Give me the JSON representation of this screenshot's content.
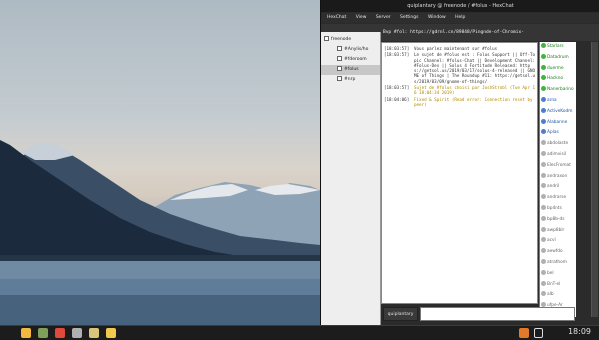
{
  "window": {
    "title": "quiplantary @ freenode / #folus - HexChat"
  },
  "menu": [
    "HexChat",
    "View",
    "Server",
    "Settings",
    "Window",
    "Help"
  ],
  "topic": "Bvp #fol: https://gdrnl.cn/89848/Pingnde-of-Chromix-",
  "tree": {
    "network": "freenode",
    "channels": [
      {
        "label": "#Anylis/ho",
        "selected": false
      },
      {
        "label": "#fderoom",
        "selected": false
      },
      {
        "label": "#folus",
        "selected": true
      },
      {
        "label": "#nrp",
        "selected": false
      }
    ]
  },
  "messages": [
    {
      "time": "[18:03:57]",
      "text": "Vous parlez maintenant sur #folus",
      "style": "normal"
    },
    {
      "time": "[18:03:57]",
      "text": "Le sujet de #folus est : Folus Support || Off-Topic Channel: #folus-Chat || Development Channel: #Folus-Dev || Solus 4 Fortitude Released: https://getsol.us/2019/03/17/solus-4-released || GNOME of Things | The Roundup #11: https://getsol.us/2019/03/09/gnome-of-things/",
      "style": "normal"
    },
    {
      "time": "[18:03:57]",
      "text": "Sujet de #folus choisi par JoshStrobl (Tue Apr 16 18:04:34 2019)",
      "style": "notice"
    },
    {
      "time": "[18:04:06]",
      "text": "Fixed & Spirit (Read error: Connection reset by peer)",
      "style": "notice"
    }
  ],
  "users": [
    {
      "name": "Starlars",
      "mode": "op"
    },
    {
      "name": "Datadrum",
      "mode": "op"
    },
    {
      "name": "duerme",
      "mode": "op"
    },
    {
      "name": "Hackno",
      "mode": "op"
    },
    {
      "name": "Nanerbarino",
      "mode": "op"
    },
    {
      "name": "arna",
      "mode": "voice"
    },
    {
      "name": "ActiveKodm",
      "mode": "voice"
    },
    {
      "name": "Alabanne",
      "mode": "voice"
    },
    {
      "name": "Aplas",
      "mode": "voice"
    },
    {
      "name": "abdolaste",
      "mode": "none"
    },
    {
      "name": "adimvisil",
      "mode": "none"
    },
    {
      "name": "ElecFromat",
      "mode": "none"
    },
    {
      "name": "andraxon",
      "mode": "none"
    },
    {
      "name": "andril",
      "mode": "none"
    },
    {
      "name": "andrarse",
      "mode": "none"
    },
    {
      "name": "bp4nts",
      "mode": "none"
    },
    {
      "name": "bp8b-ds",
      "mode": "none"
    },
    {
      "name": "awp8blr",
      "mode": "none"
    },
    {
      "name": "acvl",
      "mode": "none"
    },
    {
      "name": "aewfdo",
      "mode": "none"
    },
    {
      "name": "atrathom",
      "mode": "none"
    },
    {
      "name": "bel",
      "mode": "none"
    },
    {
      "name": "BnT-el",
      "mode": "none"
    },
    {
      "name": "alb",
      "mode": "none"
    },
    {
      "name": "ufpe-Ar",
      "mode": "none"
    }
  ],
  "input": {
    "nick": "quiplantary",
    "value": ""
  },
  "taskbar": {
    "clock": "18:09",
    "icons": [
      {
        "name": "files-icon",
        "color": "#f2b840"
      },
      {
        "name": "terminal-icon",
        "color": "#7fa05a"
      },
      {
        "name": "browser-icon",
        "color": "#e04a3a"
      },
      {
        "name": "settings-icon",
        "color": "#b0b0b0"
      },
      {
        "name": "notes-icon",
        "color": "#d9c57a"
      },
      {
        "name": "hexchat-icon",
        "color": "#f2c94c"
      }
    ]
  },
  "colors": {
    "op": "#3fb53f",
    "voice": "#4a7fd4",
    "none": "#b0b0b0"
  }
}
